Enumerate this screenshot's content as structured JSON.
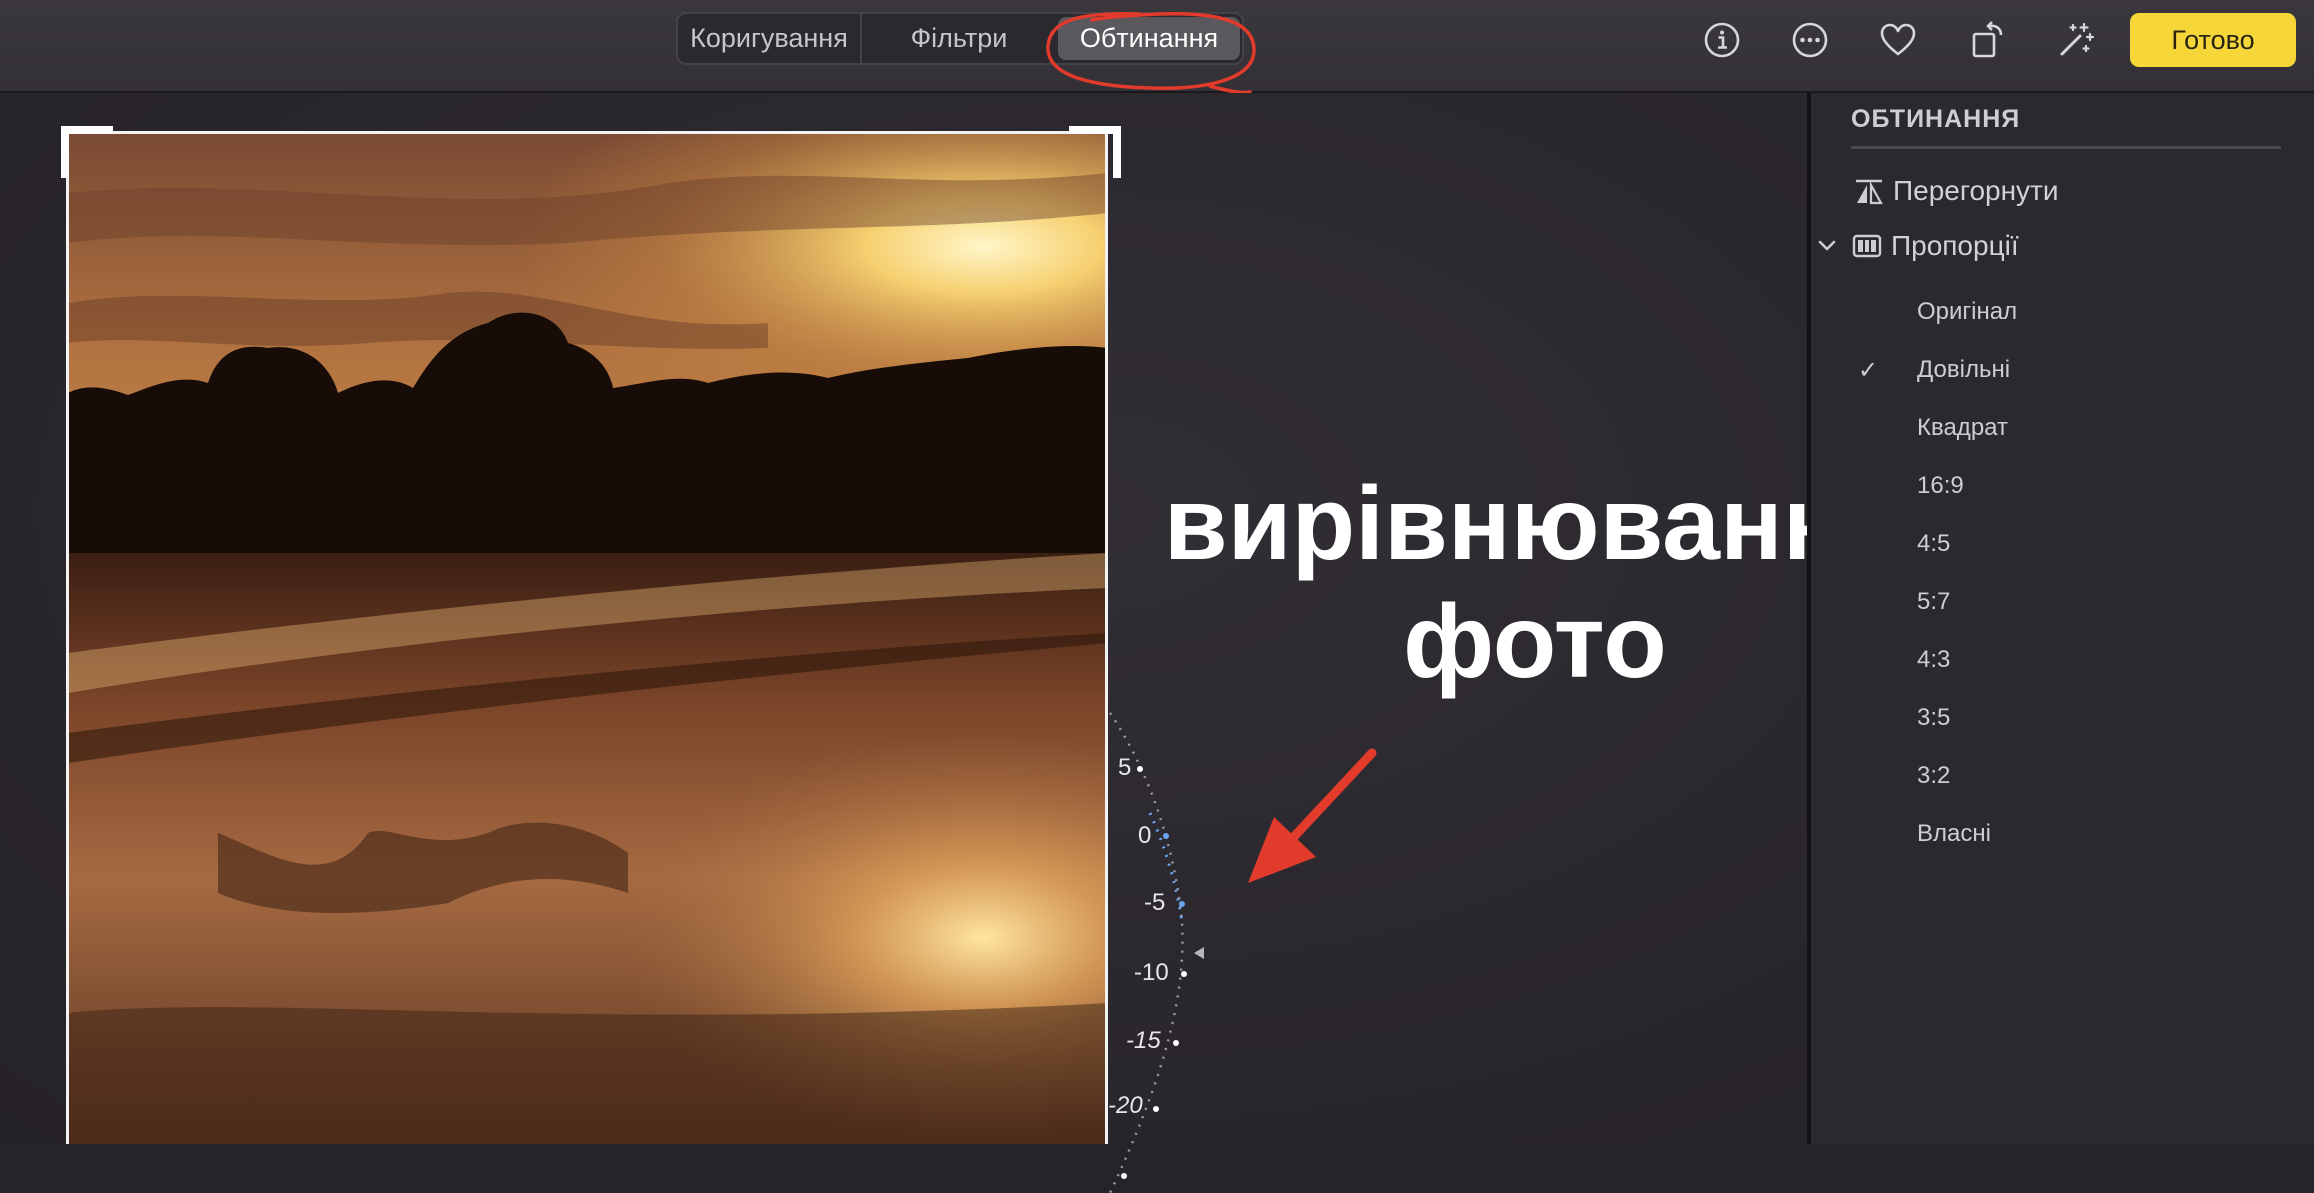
{
  "toolbar": {
    "tabs": [
      "Коригування",
      "Фільтри",
      "Обтинання"
    ],
    "active_tab": "Обтинання",
    "icons": [
      "info-icon",
      "more-icon",
      "heart-icon",
      "rotate-icon",
      "magic-wand-icon"
    ],
    "done_label": "Готово",
    "accent_color": "#f7d63a",
    "annotation_color": "#e23b2c"
  },
  "editor": {
    "overlay_text_line1": "вирівнювання",
    "overlay_text_line2": "фото",
    "dial_labels": [
      "5",
      "0",
      "-5",
      "-10",
      "-15",
      "-20"
    ]
  },
  "sidebar": {
    "title": "ОБТИНАННЯ",
    "flip_label": "Перегорнути",
    "ratio_label": "Пропорції",
    "options": [
      {
        "label": "Оригінал",
        "checked": false
      },
      {
        "label": "Довільні",
        "checked": true
      },
      {
        "label": "Квадрат",
        "checked": false
      },
      {
        "label": "16:9",
        "checked": false
      },
      {
        "label": "4:5",
        "checked": false
      },
      {
        "label": "5:7",
        "checked": false
      },
      {
        "label": "4:3",
        "checked": false
      },
      {
        "label": "3:5",
        "checked": false
      },
      {
        "label": "3:2",
        "checked": false
      },
      {
        "label": "Власні",
        "checked": false
      }
    ],
    "checkmark": "✓"
  }
}
